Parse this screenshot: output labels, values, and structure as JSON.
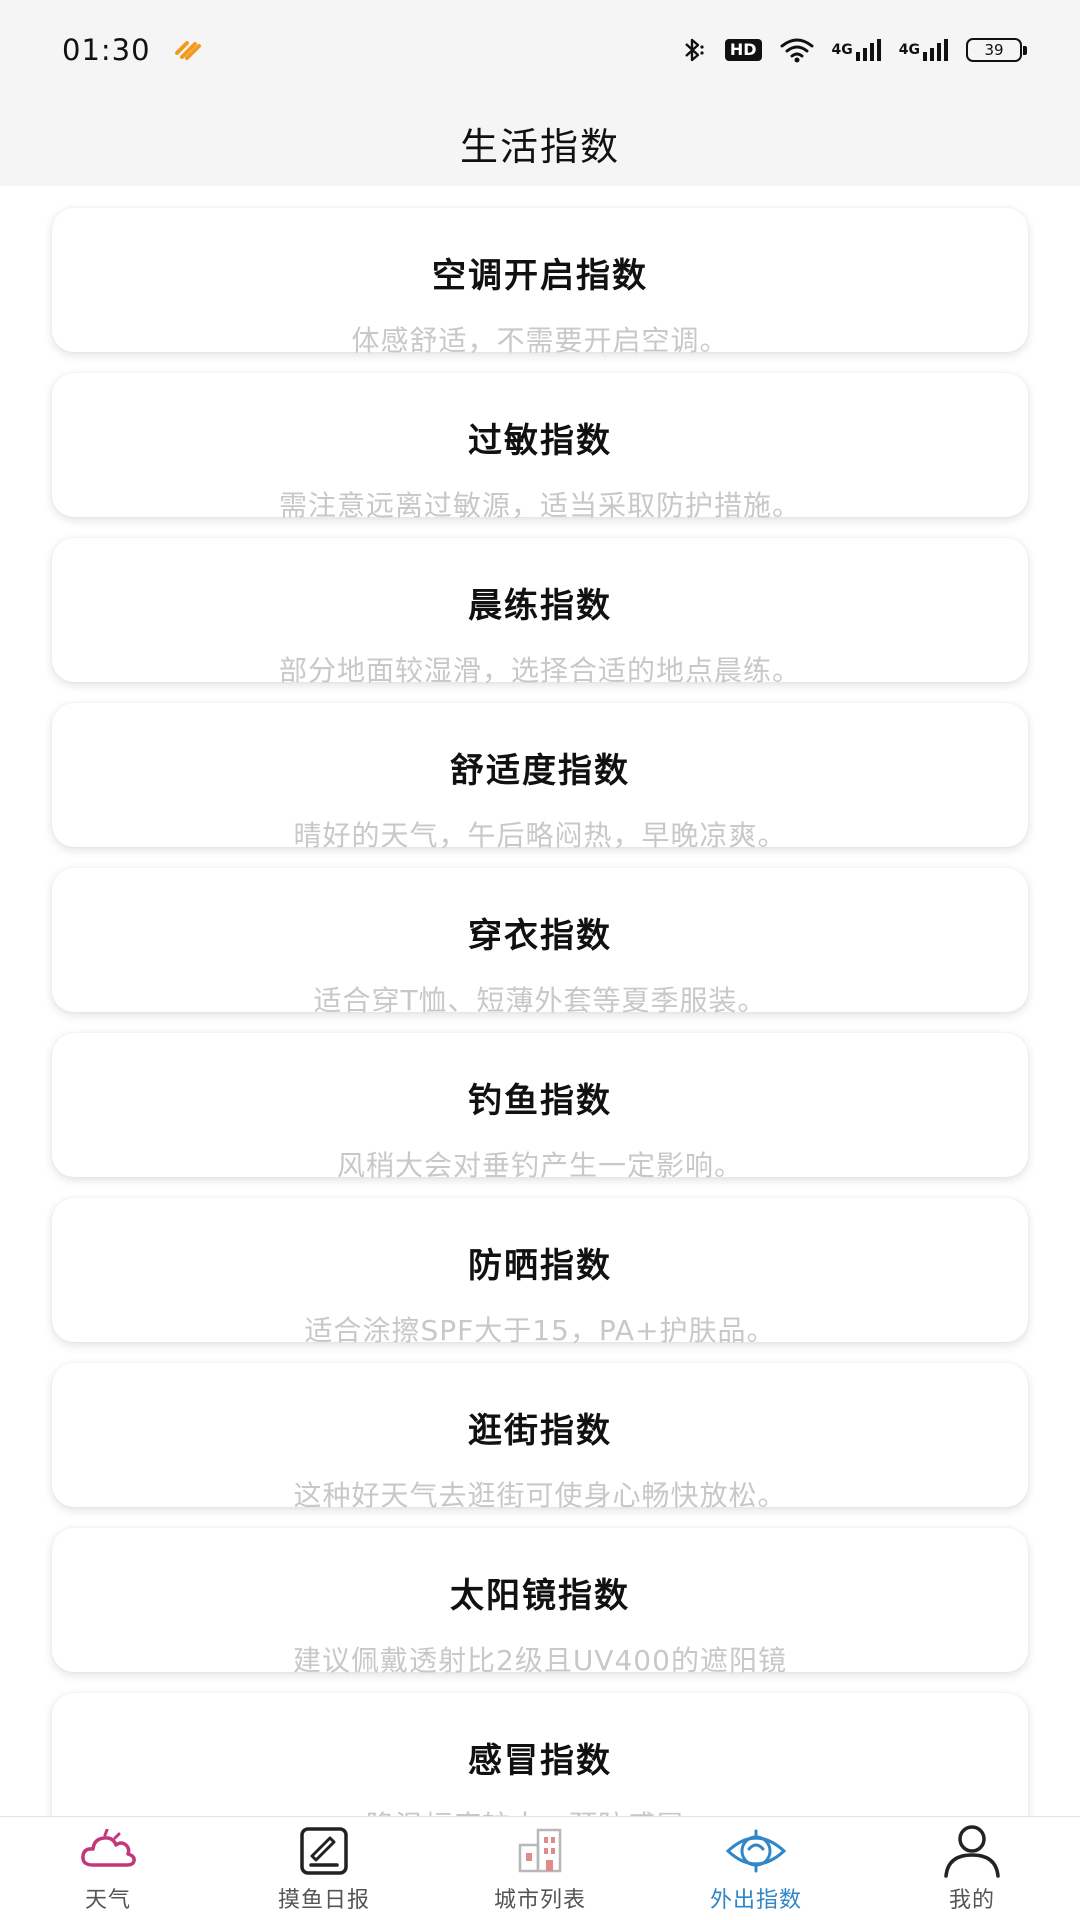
{
  "status_bar": {
    "time": "01:30",
    "hd_label": "HD",
    "net1": "4G",
    "net2": "4G",
    "battery": "39"
  },
  "header": {
    "title": "生活指数"
  },
  "cards": [
    {
      "title": "空调开启指数",
      "desc": "体感舒适，不需要开启空调。"
    },
    {
      "title": "过敏指数",
      "desc": "需注意远离过敏源，适当采取防护措施。"
    },
    {
      "title": "晨练指数",
      "desc": "部分地面较湿滑，选择合适的地点晨练。"
    },
    {
      "title": "舒适度指数",
      "desc": "晴好的天气，午后略闷热，早晚凉爽。"
    },
    {
      "title": "穿衣指数",
      "desc": "适合穿T恤、短薄外套等夏季服装。"
    },
    {
      "title": "钓鱼指数",
      "desc": "风稍大会对垂钓产生一定影响。"
    },
    {
      "title": "防晒指数",
      "desc": "适合涂擦SPF大于15，PA+护肤品。"
    },
    {
      "title": "逛街指数",
      "desc": "这种好天气去逛街可使身心畅快放松。"
    },
    {
      "title": "太阳镜指数",
      "desc": "建议佩戴透射比2级且UV400的遮阳镜"
    },
    {
      "title": "感冒指数",
      "desc": "降温幅度较大，预防感冒。"
    }
  ],
  "nav": {
    "items": [
      {
        "label": "天气",
        "icon": "cloud-icon"
      },
      {
        "label": "摸鱼日报",
        "icon": "notepad-icon"
      },
      {
        "label": "城市列表",
        "icon": "buildings-icon"
      },
      {
        "label": "外出指数",
        "icon": "eye-target-icon"
      },
      {
        "label": "我的",
        "icon": "user-icon"
      }
    ],
    "active_index": 3,
    "active_color": "#2f86c8",
    "weather_icon_color": "#c2387a"
  }
}
